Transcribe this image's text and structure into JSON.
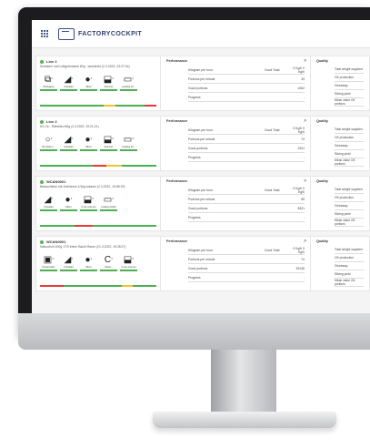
{
  "header": {
    "brand": "FACTORYCOCKPIT"
  },
  "cards": [
    {
      "title": "Line 2",
      "subtitle": "Schinken und Luftgetrocknet 80g - wechfreie (2.3.2022, 23:27:34)",
      "machines": [
        {
          "label": "Packaging",
          "icon": "⧉",
          "bar": "#4caf50"
        },
        {
          "label": "Unloader",
          "icon": "◢",
          "bar": "#4caf50"
        },
        {
          "label": "Slicer",
          "icon": "●",
          "bar": "#4caf50"
        },
        {
          "label": "Scanner",
          "icon": "⬓",
          "bar": "#4caf50"
        },
        {
          "label": "Loading for...",
          "icon": "▭",
          "bar": "#4caf50"
        }
      ],
      "status": [
        [
          "#4caf50",
          0.55
        ],
        [
          "#f4c430",
          0.1
        ],
        [
          "#4caf50",
          0.25
        ],
        [
          "#e53935",
          0.1
        ]
      ],
      "perf": [
        {
          "k": "Kilogram per hour",
          "u": "Good  Total",
          "v": "0 Kg/h  0 Kg/h"
        },
        {
          "k": "Portions per minute",
          "u": "",
          "v": "33"
        },
        {
          "k": "Good portions",
          "u": "",
          "v": "1062"
        },
        {
          "k": "Progress",
          "u": "",
          "v": "-"
        }
      ]
    },
    {
      "title": "Line 2",
      "subtitle": "KG 16 - Richelieu 80g (2.3.2022, 19:21:21)",
      "machines": [
        {
          "label": "ML Write s...",
          "icon": "○",
          "bar": "#4caf50"
        },
        {
          "label": "Unloader",
          "icon": "◢",
          "bar": "#4caf50"
        },
        {
          "label": "Slicer",
          "icon": "●",
          "bar": "#4caf50"
        },
        {
          "label": "Scanner",
          "icon": "⬓",
          "bar": "#4caf50"
        },
        {
          "label": "Loading for...",
          "icon": "▭",
          "bar": "#4caf50"
        }
      ],
      "status": [
        [
          "#4caf50",
          0.45
        ],
        [
          "#e53935",
          0.12
        ],
        [
          "#f4c430",
          0.13
        ],
        [
          "#4caf50",
          0.3
        ]
      ],
      "perf": [
        {
          "k": "Kilogram per hour",
          "u": "Good  Total",
          "v": "0 Kg/h  0 Kg/h"
        },
        {
          "k": "Portions per minute",
          "u": "",
          "v": "74"
        },
        {
          "k": "Good portions",
          "u": "",
          "v": "2341"
        },
        {
          "k": "Progress",
          "u": "",
          "v": "-"
        }
      ]
    },
    {
      "title": "WCAN0001",
      "subtitle": "Barauchstue mit Jelehewm 1/1kg solauer (2.3.2022, 19:58:19)",
      "machines": [
        {
          "label": "Unloader",
          "icon": "◢",
          "bar": "#4caf50"
        },
        {
          "label": "Slicer",
          "icon": "●",
          "bar": "#4caf50"
        },
        {
          "label": "X-ray scanner",
          "icon": "⬓",
          "bar": "#4caf50"
        },
        {
          "label": "Loading buffer",
          "icon": "▭",
          "bar": "#4caf50"
        }
      ],
      "status": [
        [
          "#4caf50",
          0.3
        ],
        [
          "#e53935",
          0.15
        ],
        [
          "#4caf50",
          0.55
        ]
      ],
      "perf": [
        {
          "k": "Kilogram per hour",
          "u": "Good  Total",
          "v": "0 Kg/h  0 Kg/h"
        },
        {
          "k": "Portions per minute",
          "u": "",
          "v": "65"
        },
        {
          "k": "Good portions",
          "u": "",
          "v": "8321"
        },
        {
          "k": "Progress",
          "u": "",
          "v": "-"
        }
      ]
    },
    {
      "title": "WCAN0001",
      "subtitle": "Natuurtuin 400g 17/3 Intern Bacht Rauer (21.3.2022, 19:28:27)",
      "machines": [
        {
          "label": "Dosierzader",
          "icon": "▣",
          "bar": "#4caf50"
        },
        {
          "label": "Unloader",
          "icon": "◢",
          "bar": "#4caf50"
        },
        {
          "label": "Slicer",
          "icon": "●",
          "bar": "#4caf50"
        },
        {
          "label": "Classi...",
          "icon": "C",
          "bar": "#4caf50"
        },
        {
          "label": "X-ray scanner",
          "icon": "⬓",
          "bar": "#4caf50"
        }
      ],
      "status": [
        [
          "#e53935",
          0.2
        ],
        [
          "#4caf50",
          0.5
        ],
        [
          "#f4c430",
          0.1
        ],
        [
          "#4caf50",
          0.2
        ]
      ],
      "perf": [
        {
          "k": "Kilogram per hour",
          "u": "Good  Total",
          "v": "0 Kg/h  0 Kg/h"
        },
        {
          "k": "Portions per minute",
          "u": "",
          "v": "74"
        },
        {
          "k": "Good portions",
          "u": "",
          "v": "53136"
        },
        {
          "k": "Progress",
          "u": "",
          "v": "-"
        }
      ]
    }
  ],
  "labels": {
    "performance": "Performance",
    "quality": "Quality",
    "arrow": ">"
  },
  "quality_rows": [
    "Total weight supplied",
    "OK production",
    "Giveaway",
    "Slicing yield",
    "Mean value OK portions"
  ]
}
